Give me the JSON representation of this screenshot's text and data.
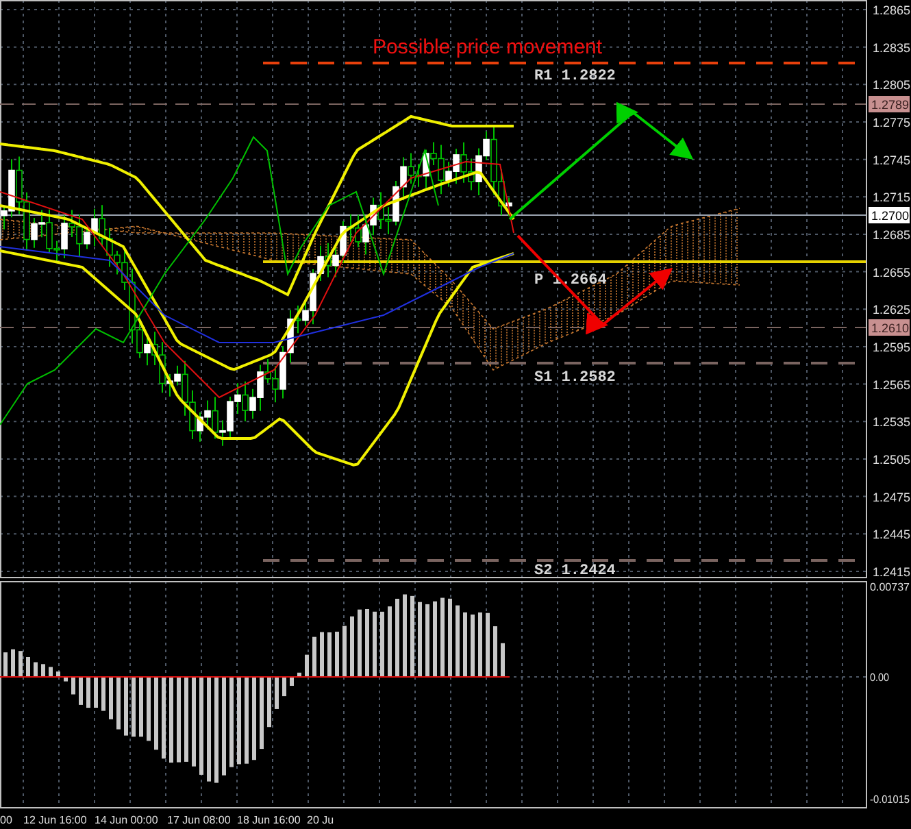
{
  "chart": {
    "title": "Possible price movement",
    "price_axis": [
      "1.2865",
      "1.2835",
      "1.2805",
      "1.2775",
      "1.2745",
      "1.2715",
      "1.2685",
      "1.2655",
      "1.2625",
      "1.2595",
      "1.2565",
      "1.2535",
      "1.2505",
      "1.2475",
      "1.2445",
      "1.2415"
    ],
    "price_tags": [
      {
        "label": "1.2789",
        "kind": "level"
      },
      {
        "label": "1.2700",
        "kind": "current"
      },
      {
        "label": "1.2610",
        "kind": "level"
      }
    ],
    "levels": [
      {
        "label": "R1 1.2822",
        "kind": "resistance",
        "color": "#e8400c"
      },
      {
        "label": "P 1.2664",
        "kind": "pivot",
        "color": "#e6d200"
      },
      {
        "label": "S1 1.2582",
        "kind": "support",
        "color": "#7a6460"
      },
      {
        "label": "S2 1.2424",
        "kind": "support",
        "color": "#7a6460"
      }
    ]
  },
  "oscillator": {
    "axis": [
      "0.00737",
      "0.00",
      "-0.01015"
    ]
  },
  "time_axis": [
    "00",
    "12 Jun 16:00",
    "14 Jun 00:00",
    "17 Jun 08:00",
    "18 Jun 16:00",
    "20 Ju"
  ]
}
